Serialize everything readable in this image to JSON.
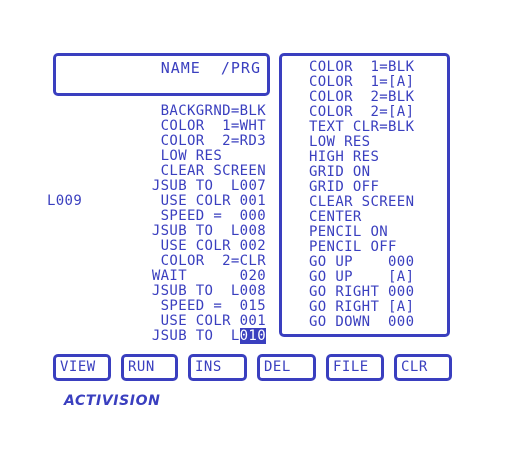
{
  "name_box": {
    "label": "NAME  /PRG"
  },
  "program_lines": [
    {
      "label": "",
      "text": "BACKGRND=BLK"
    },
    {
      "label": "",
      "text": "COLOR  1=WHT"
    },
    {
      "label": "",
      "text": "COLOR  2=RD3"
    },
    {
      "label": "",
      "text": "LOW RES     "
    },
    {
      "label": "",
      "text": "CLEAR SCREEN"
    },
    {
      "label": "",
      "text": "JSUB TO  L007"
    },
    {
      "label": "L009",
      "text": "USE COLR 001"
    },
    {
      "label": "",
      "text": "SPEED =  000"
    },
    {
      "label": "",
      "text": "JSUB TO  L008"
    },
    {
      "label": "",
      "text": "USE COLR 002"
    },
    {
      "label": "",
      "text": "COLOR  2=CLR"
    },
    {
      "label": "",
      "text": "WAIT      020"
    },
    {
      "label": "",
      "text": "JSUB TO  L008"
    },
    {
      "label": "",
      "text": "SPEED =  015"
    },
    {
      "label": "",
      "text": "USE COLR 001"
    },
    {
      "label": "",
      "text": "JSUB TO  L",
      "cursor_text": "010"
    }
  ],
  "command_menu": [
    "COLOR  1=BLK",
    "COLOR  1=[A]",
    "COLOR  2=BLK",
    "COLOR  2=[A]",
    "TEXT CLR=BLK",
    "LOW RES",
    "HIGH RES",
    "GRID ON",
    "GRID OFF",
    "CLEAR SCREEN",
    "CENTER",
    "PENCIL ON",
    "PENCIL OFF",
    "GO UP    000",
    "GO UP    [A]",
    "GO RIGHT 000",
    "GO RIGHT [A]",
    "GO DOWN  000"
  ],
  "buttons": [
    "VIEW",
    "RUN",
    "INS",
    "DEL",
    "FILE",
    "CLR"
  ],
  "logo": "ACTIVISION",
  "colors": {
    "foreground": "#3a3fbf",
    "background": "#ffffff"
  }
}
